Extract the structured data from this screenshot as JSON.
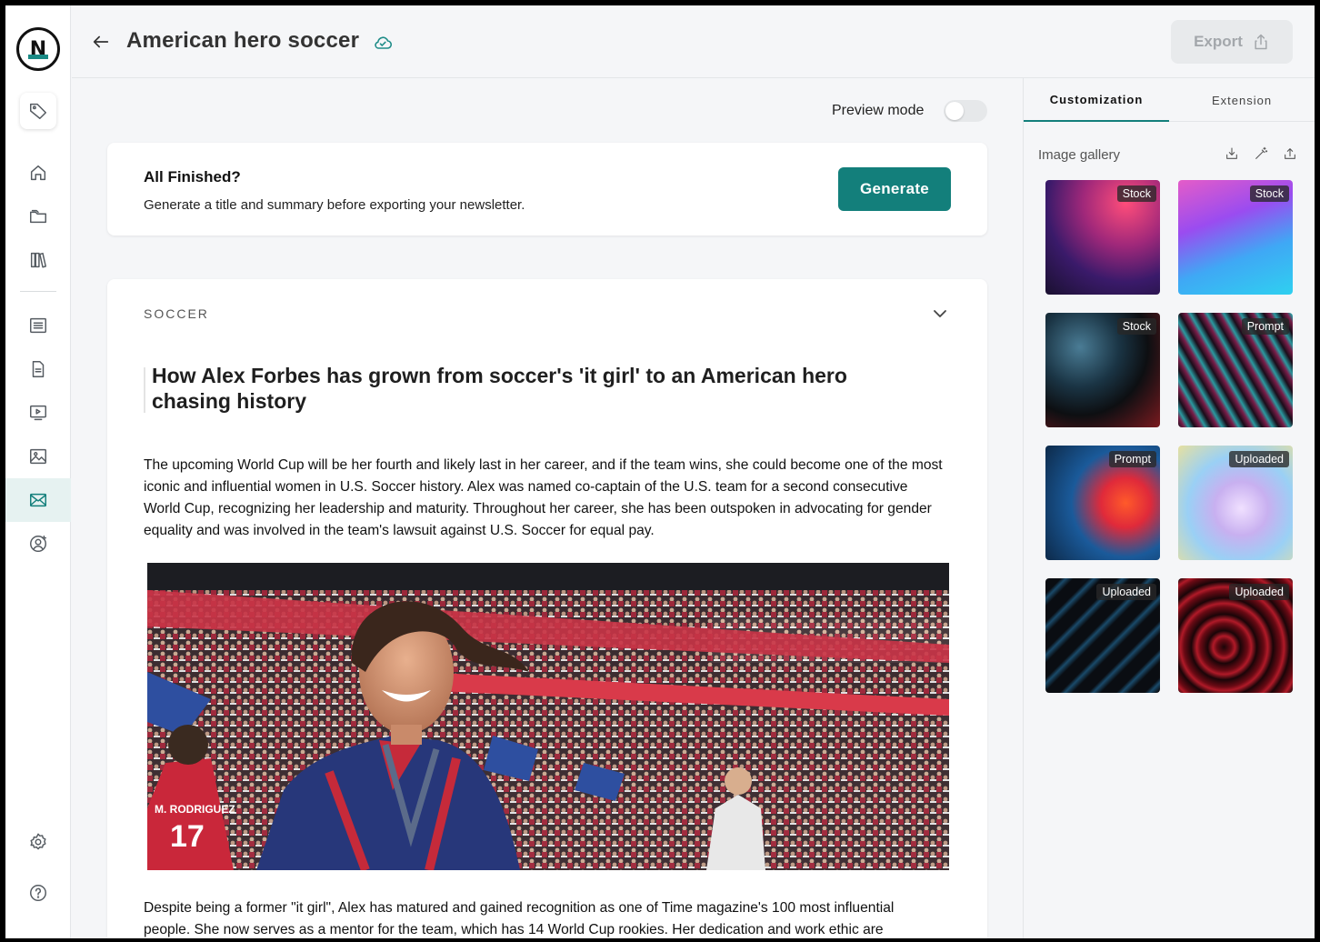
{
  "header": {
    "title": "American hero soccer",
    "export_label": "Export"
  },
  "sidebar": {
    "items": [
      "tag",
      "home",
      "folders",
      "library",
      "articles",
      "document",
      "video",
      "images",
      "newsletter",
      "account"
    ],
    "bottom": [
      "settings",
      "help"
    ]
  },
  "preview": {
    "label": "Preview mode",
    "enabled": false
  },
  "finish_card": {
    "title": "All Finished?",
    "subtitle": "Generate a title and summary before exporting your newsletter.",
    "button": "Generate"
  },
  "article": {
    "section": "SOCCER",
    "headline": "How Alex Forbes has grown from soccer's 'it girl' to an American hero chasing history",
    "paragraph1": "The upcoming World Cup will be her fourth and likely last in her career, and if the team wins, she could become one of the most iconic and influential women in U.S. Soccer history. Alex was named co-captain of the U.S. team for a second consecutive World Cup, recognizing her leadership and maturity. Throughout her career, she has been outspoken in advocating for gender equality and was involved in the team's lawsuit against U.S. Soccer for equal pay.",
    "paragraph2": "Despite being a former \"it girl\", Alex has matured and gained recognition as one of Time magazine's 100 most influential people. She now serves as a mentor for the team, which has 14 World Cup rookies. Her dedication and work ethic are",
    "photo_jersey_text": "M. RODRIGUEZ",
    "photo_jersey_number": "17"
  },
  "panel": {
    "tabs": [
      "Customization",
      "Extension"
    ],
    "active_tab": "Customization",
    "gallery_title": "Image gallery",
    "gallery": [
      {
        "badge": "Stock"
      },
      {
        "badge": "Stock"
      },
      {
        "badge": "Stock"
      },
      {
        "badge": "Prompt"
      },
      {
        "badge": "Prompt"
      },
      {
        "badge": "Uploaded"
      },
      {
        "badge": "Uploaded"
      },
      {
        "badge": "Uploaded"
      }
    ]
  },
  "colors": {
    "accent": "#137f7b",
    "active_nav_bg": "#e6f2f1",
    "background": "#f5f6f8"
  }
}
